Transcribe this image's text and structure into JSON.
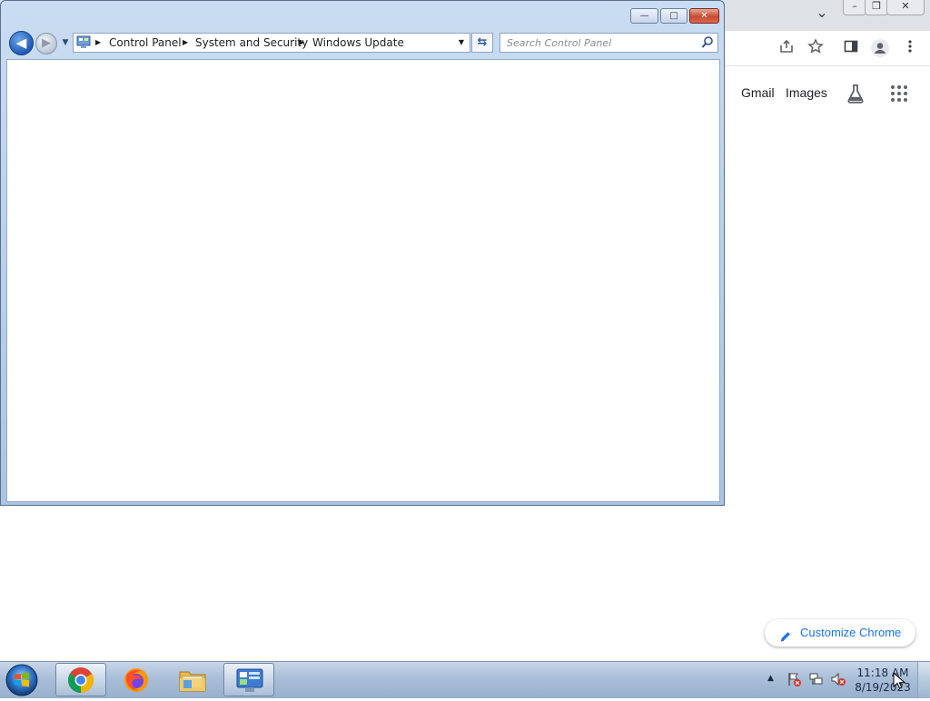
{
  "explorer_window": {
    "breadcrumbs": [
      "Control Panel",
      "System and Security",
      "Windows Update"
    ],
    "search_placeholder": "Search Control Panel",
    "caption_buttons": {
      "minimize_glyph": "—",
      "maximize_glyph": "□",
      "close_glyph": "✕"
    },
    "back_glyph": "◀",
    "forward_glyph": "▶",
    "recent_glyph": "▼",
    "dropdown_glyph": "▼",
    "refresh_glyph": "⇆"
  },
  "chrome_window": {
    "header_links": {
      "gmail": "Gmail",
      "images": "Images"
    },
    "customize_label": "Customize Chrome",
    "controls": {
      "dropdown_glyph": "⌄",
      "minimize_glyph": "–",
      "restore_glyph": "❐",
      "close_glyph": "✕"
    },
    "toolbar_icons": [
      "share-icon",
      "bookmark-star-icon",
      "side-panel-icon",
      "profile-icon",
      "more-menu-icon"
    ]
  },
  "taskbar": {
    "pinned_apps": [
      "google-chrome-icon",
      "firefox-icon",
      "file-explorer-icon",
      "control-panel-icon"
    ],
    "active_app": "control-panel-icon",
    "tray": {
      "overflow_glyph": "▲",
      "clock_time": "11:18 AM",
      "clock_date": "8/19/2023"
    }
  },
  "colors": {
    "win7_frame": "#b7cfe9",
    "chrome_accent": "#1a73e8",
    "taskbar": "#a8bed8",
    "close_button": "#c94a32"
  }
}
